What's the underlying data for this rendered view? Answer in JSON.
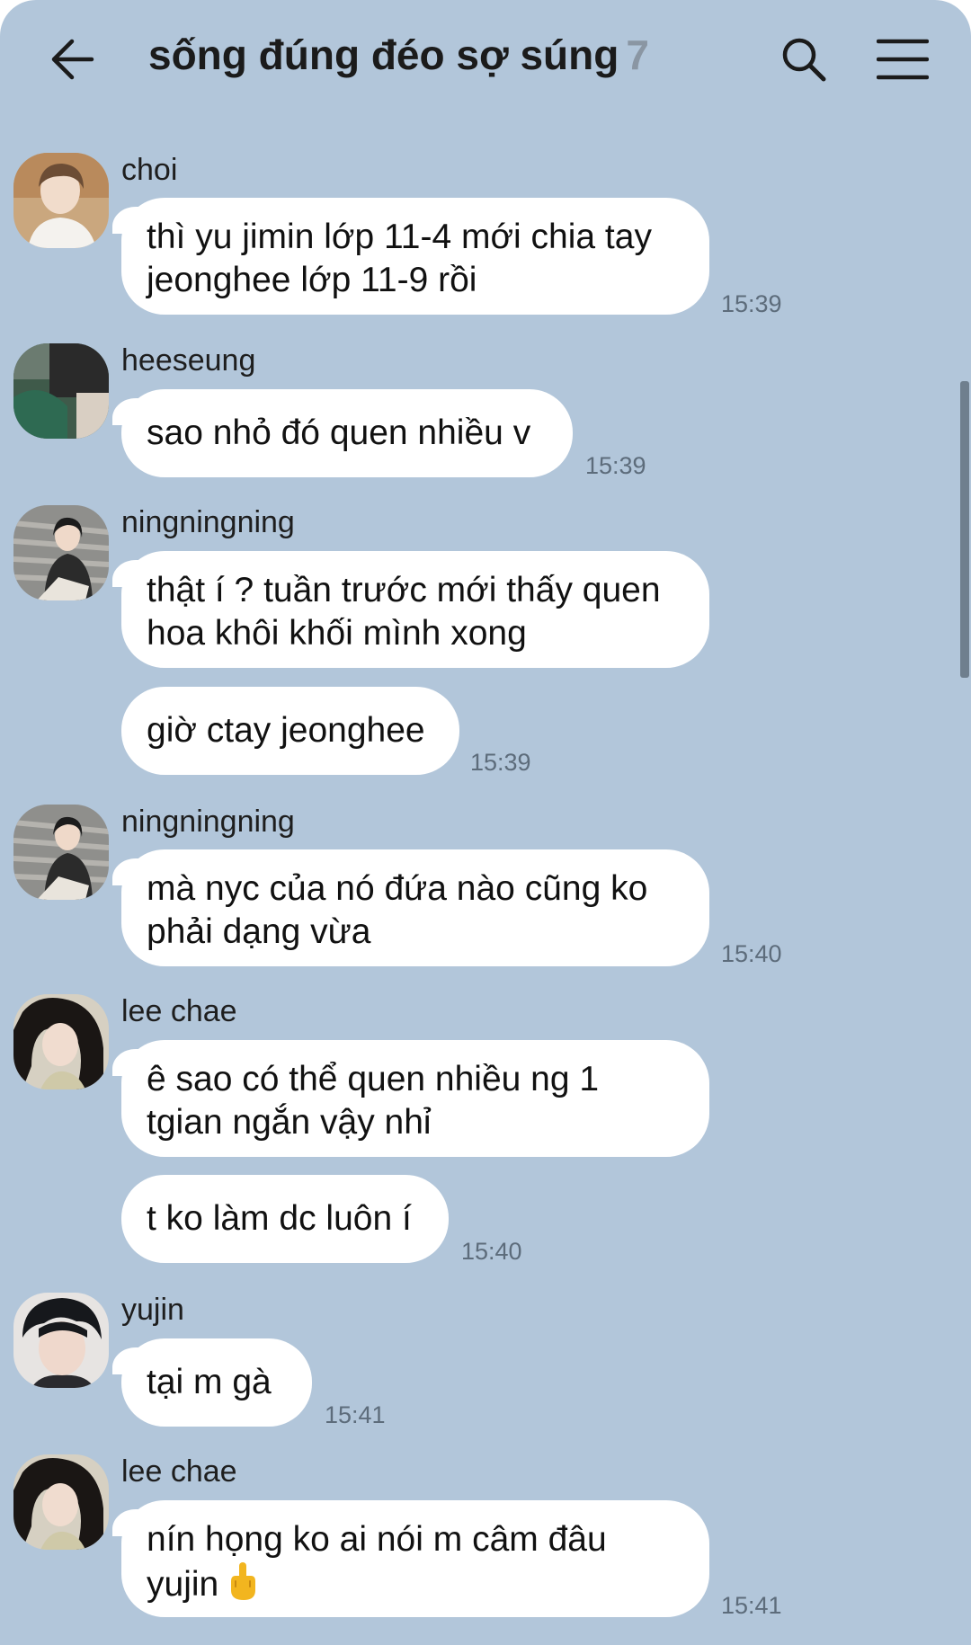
{
  "header": {
    "title": "sống đúng đéo sợ súng",
    "member_count": "7"
  },
  "icons": {
    "back": "arrow-left-icon",
    "search": "search-icon",
    "menu": "hamburger-menu-icon"
  },
  "messages": [
    {
      "sender": "choi",
      "lines": [
        "thì yu jimin lớp 11-4 mới chia tay",
        "jeonghee lớp 11-9 rồi"
      ],
      "time": "15:39"
    },
    {
      "sender": "heeseung",
      "lines": [
        "sao nhỏ đó quen nhiều v"
      ],
      "time": "15:39"
    },
    {
      "sender": "ningningning",
      "lines": [
        "thật í ? tuần trước mới thấy quen",
        "hoa khôi khối mình xong"
      ]
    },
    {
      "lines": [
        "giờ ctay jeonghee"
      ],
      "time": "15:39"
    },
    {
      "sender": "ningningning",
      "lines": [
        "mà nyc của nó đứa nào cũng ko",
        "phải dạng vừa"
      ],
      "time": "15:40"
    },
    {
      "sender": "lee chae",
      "lines": [
        "ê sao có thể quen nhiều ng 1",
        "tgian ngắn vậy nhỉ"
      ]
    },
    {
      "lines": [
        "t ko làm dc luôn í"
      ],
      "time": "15:40"
    },
    {
      "sender": "yujin",
      "lines": [
        "tại m gà"
      ],
      "time": "15:41"
    },
    {
      "sender": "lee chae",
      "lines": [
        "nín họng ko ai nói m câm đâu",
        "yujin"
      ],
      "emoji": "middle-finger-emoji",
      "time": "15:41"
    }
  ],
  "colors": {
    "background": "#b2c6da",
    "bubble": "#ffffff",
    "timestamp": "#5d6c7b",
    "member_count": "#8a96a3"
  }
}
